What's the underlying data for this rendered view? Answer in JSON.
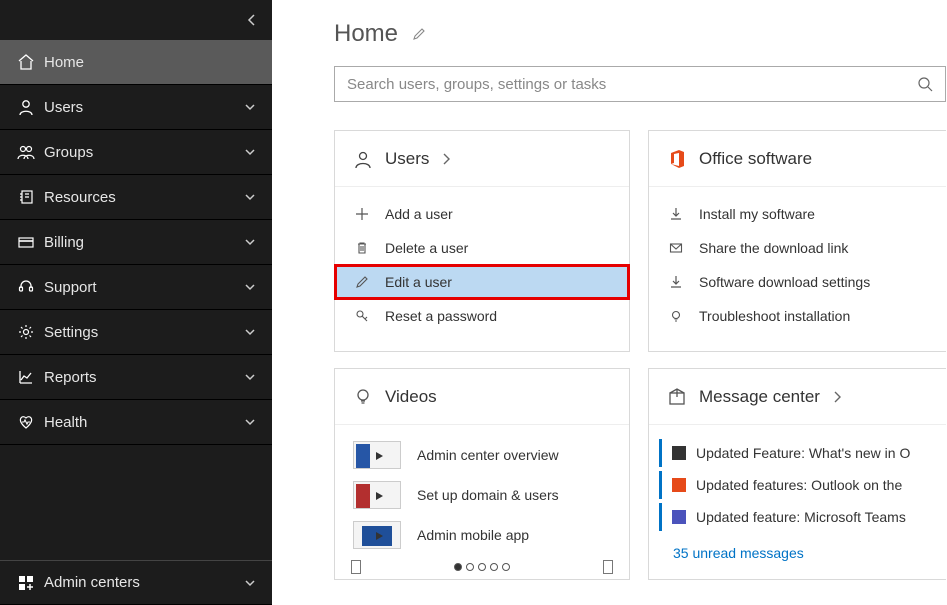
{
  "sidebar": {
    "items": [
      {
        "label": "Home"
      },
      {
        "label": "Users"
      },
      {
        "label": "Groups"
      },
      {
        "label": "Resources"
      },
      {
        "label": "Billing"
      },
      {
        "label": "Support"
      },
      {
        "label": "Settings"
      },
      {
        "label": "Reports"
      },
      {
        "label": "Health"
      },
      {
        "label": "Admin centers"
      }
    ]
  },
  "header": {
    "title": "Home"
  },
  "search": {
    "placeholder": "Search users, groups, settings or tasks"
  },
  "users_card": {
    "title": "Users",
    "items": {
      "add": "Add a user",
      "delete": "Delete a user",
      "edit": "Edit a user",
      "reset": "Reset a password"
    }
  },
  "office_card": {
    "title": "Office software",
    "items": {
      "install": "Install my software",
      "share": "Share the download link",
      "settings": "Software download settings",
      "troubleshoot": "Troubleshoot installation"
    }
  },
  "videos_card": {
    "title": "Videos",
    "items": {
      "v1": "Admin center overview",
      "v2": "Set up domain & users",
      "v3": "Admin mobile app"
    }
  },
  "msg_card": {
    "title": "Message center",
    "items": {
      "m1": "Updated Feature: What's new in O",
      "m2": "Updated features: Outlook on the",
      "m3": "Updated feature: Microsoft Teams"
    },
    "unread": "35 unread messages"
  }
}
